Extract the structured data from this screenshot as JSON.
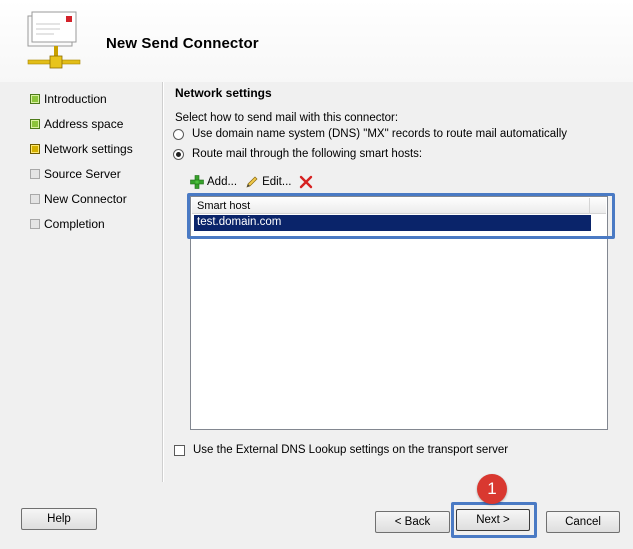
{
  "wizard": {
    "title": "New Send Connector"
  },
  "steps": [
    {
      "label": "Introduction",
      "state": "done"
    },
    {
      "label": "Address space",
      "state": "done"
    },
    {
      "label": "Network settings",
      "state": "active"
    },
    {
      "label": "Source Server",
      "state": "pending"
    },
    {
      "label": "New Connector",
      "state": "pending"
    },
    {
      "label": "Completion",
      "state": "pending"
    }
  ],
  "main": {
    "section_title": "Network settings",
    "prompt": "Select how to send mail with this connector:",
    "radio_dns": "Use domain name system (DNS) \"MX\" records to route mail automatically",
    "radio_smarthost": "Route mail through the following smart hosts:",
    "selected_option": "smarthost",
    "toolbar": {
      "add": "Add...",
      "edit": "Edit..."
    },
    "list": {
      "column_header": "Smart host",
      "rows": [
        "test.domain.com"
      ]
    },
    "external_dns_checkbox": "Use the External DNS Lookup settings on the transport server",
    "external_dns_checked": false
  },
  "footer": {
    "help": "Help",
    "back": "< Back",
    "next": "Next >",
    "cancel": "Cancel"
  },
  "annotation": {
    "badge": "1",
    "highlight_color": "#4a7ac4",
    "badge_color": "#d93830"
  },
  "icons": {
    "add": "green-plus-icon",
    "edit": "pencil-icon",
    "delete": "red-x-icon"
  }
}
